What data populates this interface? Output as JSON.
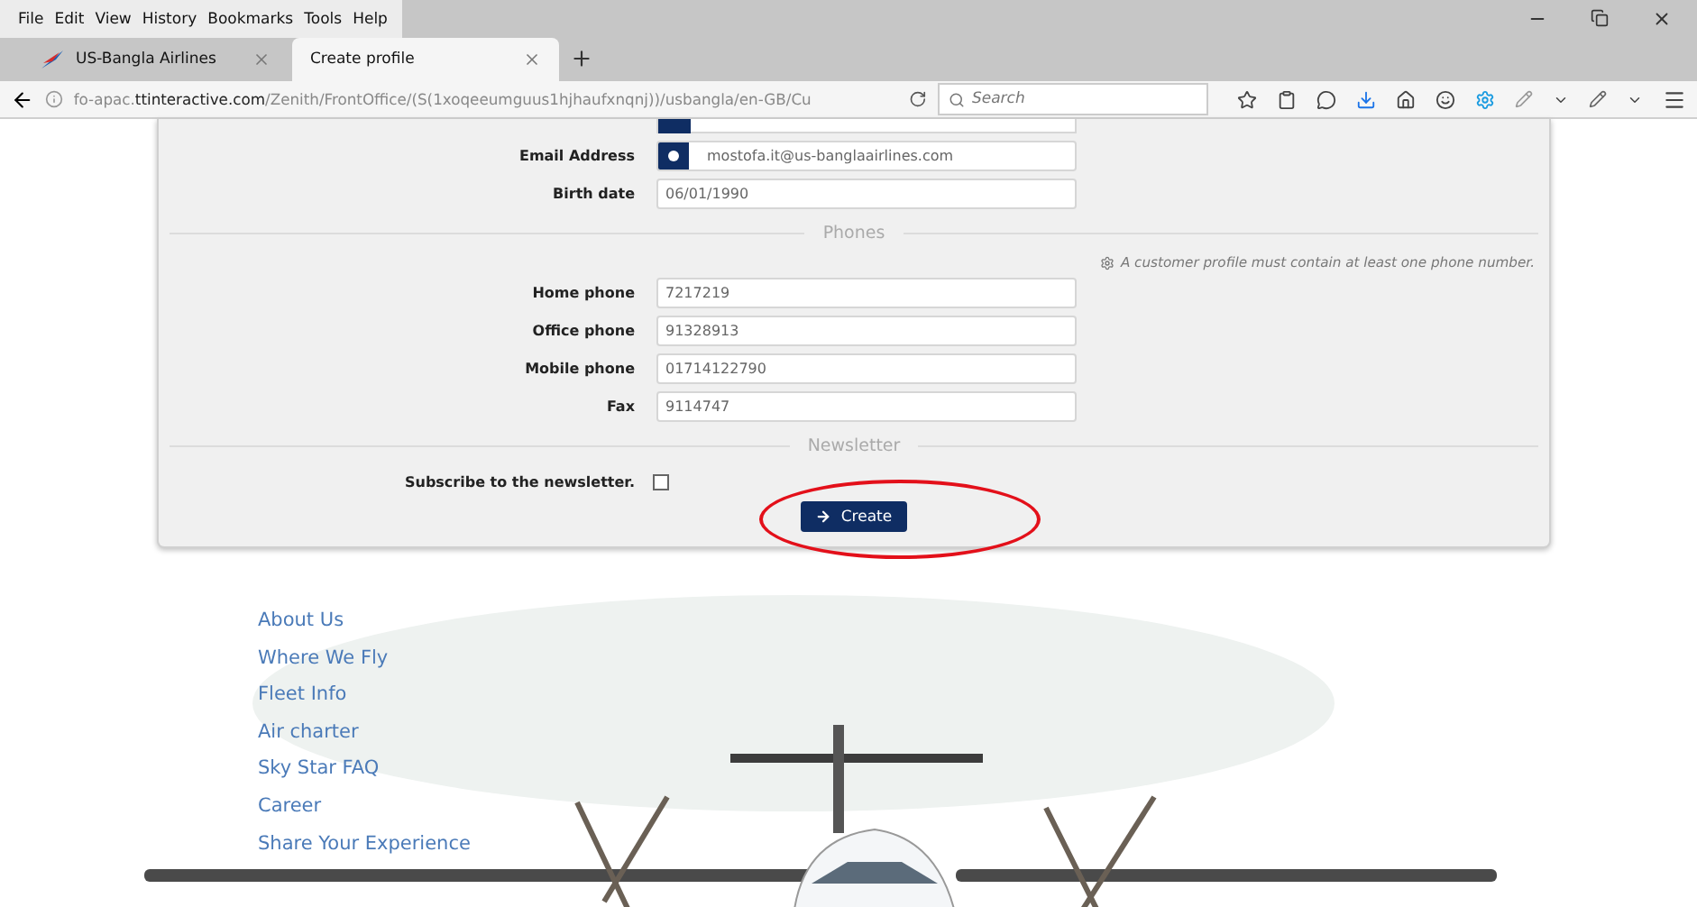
{
  "menu_bar": [
    "File",
    "Edit",
    "View",
    "History",
    "Bookmarks",
    "Tools",
    "Help"
  ],
  "tabs": [
    {
      "title": "US-Bangla Airlines",
      "selected": false
    },
    {
      "title": "Create profile",
      "selected": true
    }
  ],
  "address_bar": {
    "url": "fo-apac.**ttinteractive.com**/Zenith/FrontOffice/(S(1xoqeeumguus1hjhaufxnqnj))/usbangla/en-GB/Cu"
  },
  "search": {
    "placeholder": "Search"
  },
  "form": {
    "fields": [
      {
        "label": "Email Address",
        "value": "mostofa.it@us-banglaairlines.com",
        "kind": "icon"
      },
      {
        "label": "Birth date",
        "value": "06/01/1990",
        "kind": "plain"
      }
    ],
    "phones_title": "Phones",
    "phones_note": "A customer profile must contain at least one phone number.",
    "phones": [
      {
        "label": "Home phone",
        "value": "7217219"
      },
      {
        "label": "Office phone",
        "value": "91328913"
      },
      {
        "label": "Mobile phone",
        "value": "01714122790"
      },
      {
        "label": "Fax",
        "value": "9114747"
      }
    ],
    "newsletter_title": "Newsletter",
    "subscribe": {
      "label": "Subscribe to the newsletter.",
      "checked": false
    },
    "create_button": "Create"
  },
  "footer_links": [
    "About Us",
    "Where We Fly",
    "Fleet Info",
    "Air charter",
    "Sky Star FAQ",
    "Career",
    "Share Your Experience"
  ]
}
